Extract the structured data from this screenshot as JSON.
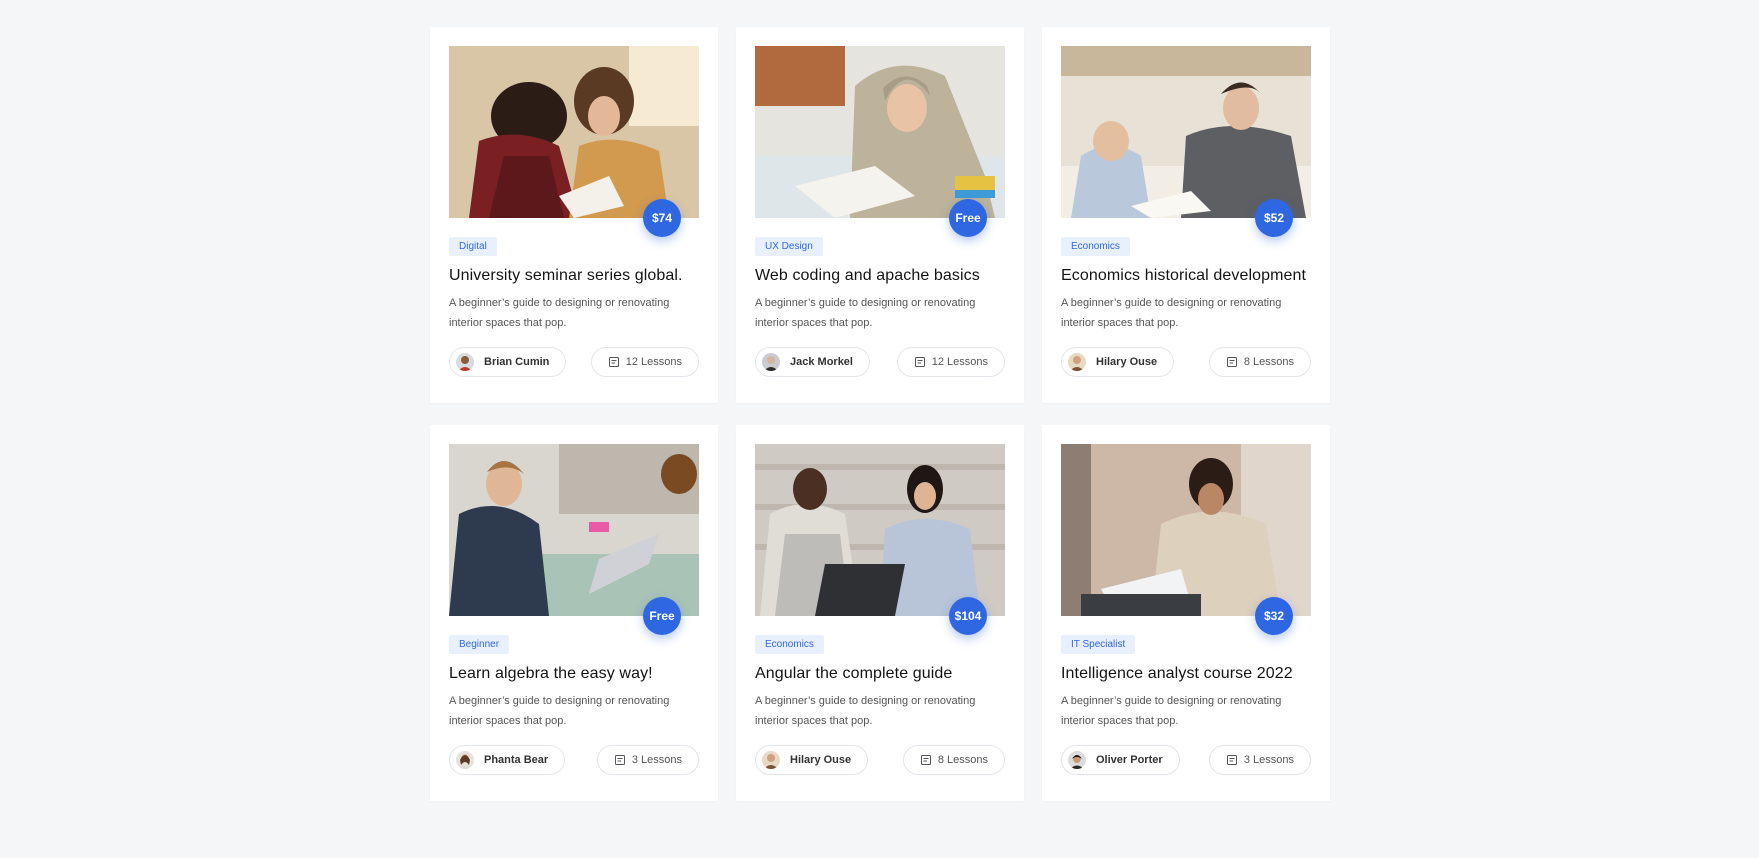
{
  "colors": {
    "accent": "#2f67e3",
    "tag_bg": "#e9f0fd",
    "page_bg": "#f5f6f8"
  },
  "courses": [
    {
      "price": "$74",
      "tag": "Digital",
      "title": "University seminar series global.",
      "desc": "A beginner’s guide to designing or renovating interior spaces that pop.",
      "author": "Brian Cumin",
      "lessons": "12 Lessons",
      "image": "two-students-reading-book"
    },
    {
      "price": "Free",
      "tag": "UX Design",
      "title": "Web coding and apache basics",
      "desc": "A beginner’s guide to designing or renovating interior spaces that pop.",
      "author": "Jack Morkel",
      "lessons": "12 Lessons",
      "image": "student-in-hoodie-studying"
    },
    {
      "price": "$52",
      "tag": "Economics",
      "title": "Economics historical development",
      "desc": "A beginner’s guide to designing or renovating interior spaces that pop.",
      "author": "Hilary Ouse",
      "lessons": "8 Lessons",
      "image": "two-students-at-desk"
    },
    {
      "price": "Free",
      "tag": "Beginner",
      "title": "Learn algebra the easy way!",
      "desc": "A beginner’s guide to designing or renovating interior spaces that pop.",
      "author": "Phanta Bear",
      "lessons": "3 Lessons",
      "image": "student-with-laptop-classroom"
    },
    {
      "price": "$104",
      "tag": "Economics",
      "title": "Angular the complete guide",
      "desc": "A beginner’s guide to designing or renovating interior spaces that pop.",
      "author": "Hilary Ouse",
      "lessons": "8 Lessons",
      "image": "two-students-with-laptop-steps"
    },
    {
      "price": "$32",
      "tag": "IT Specialist",
      "title": "Intelligence analyst course 2022",
      "desc": "A beginner’s guide to designing or renovating interior spaces that pop.",
      "author": "Oliver Porter",
      "lessons": "3 Lessons",
      "image": "student-with-headphones-writing"
    }
  ]
}
